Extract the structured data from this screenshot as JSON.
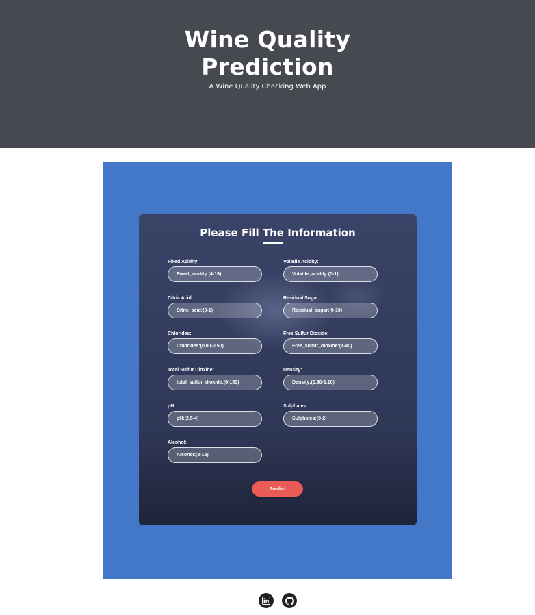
{
  "header": {
    "title_line1": "Wine Quality",
    "title_line2": "Prediction",
    "subtitle": "A Wine Quality Checking Web App"
  },
  "form": {
    "title": "Please Fill The Information",
    "fields": [
      {
        "label": "Fixed Acidity:",
        "placeholder": "Fixed_acidity:(4-16)"
      },
      {
        "label": "Volatile Acidity:",
        "placeholder": "Volatile_acidity:(0-1)"
      },
      {
        "label": "Citric Acid:",
        "placeholder": "Citric_acid:(0-1)"
      },
      {
        "label": "Residual Sugar:",
        "placeholder": "Residual_sugar:(0-10)"
      },
      {
        "label": "Chlorides:",
        "placeholder": "Chlorides:(0.00-0.50)"
      },
      {
        "label": "Free Sulfur Dioxide:",
        "placeholder": "Free_sulfur_dioxide:(1-40)"
      },
      {
        "label": "Total Sulfur Dioxide:",
        "placeholder": "total_sulfur_dioxide:(6-150)"
      },
      {
        "label": "Density:",
        "placeholder": "Density:(0.90-1.10)"
      },
      {
        "label": "pH:",
        "placeholder": "pH:(2.5-4)"
      },
      {
        "label": "Sulphates:",
        "placeholder": "Sulphates:(0-2)"
      },
      {
        "label": "Alcohol:",
        "placeholder": "Alcohol:(8-15)"
      }
    ],
    "submit_label": "Predict"
  },
  "footer": {
    "icons": [
      "linkedin-icon",
      "github-icon"
    ]
  },
  "colors": {
    "header_bg": "#464a50",
    "panel_bg": "#4377c8",
    "button_bg": "#ea5a57"
  }
}
